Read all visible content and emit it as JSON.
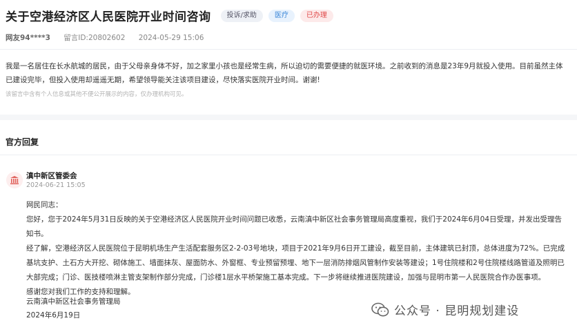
{
  "page": {
    "title": "关于空港经济区人民医院开业时间咨询",
    "tags": [
      "投诉/求助",
      "医疗",
      "已办理"
    ]
  },
  "meta": {
    "user": "网友94****3",
    "message_id": "留言ID:20802602",
    "datetime": "2024-05-29 15:06"
  },
  "message": {
    "body": "我是一名居住在长水航城的居民，由于父母亲身体不好，加之家里小孩也是经常生病，所以迫切的需要便捷的就医环境。之前收到的消息是23年9月就投入使用。目前虽然主体已建设完毕，但投入使用却遥遥无期，希望领导能关注该项目建设，尽快落实医院开业时间。谢谢!",
    "note": "该留言中含有个人信息或其他不便公开展示的内容，仅办理机构可见。"
  },
  "official_reply": {
    "section_title": "官方回复",
    "org_name": "滇中新区管委会",
    "date": "2024-06-21 15:05",
    "greeting": "网民同志：",
    "paragraph1": "您好，您于2024年5月31日反映的关于空港经济区人民医院开业时间问题已收悉，云南滇中新区社会事务管理局高度重视，我们于2024年6月04日受理，并发出受理告知书。",
    "paragraph2": "经了解，空港经济区人民医院位于昆明机场生产生活配套服务区2-2-03号地块，项目于2021年9月6日开工建设，截至目前，主体建筑已封顶，总体进度为72%。已完成基坑支护、土石方大开挖、砌体施工、墙面抹灰、屋面防水、外窗框、专业预留预埋、地下一层消防排烟风管制作安装等建设；1号住院楼和2号住院楼线路管道及照明已大部完成；门诊、医技楼喷淋主管支架制作部分完成，门诊楼1层水平桥架施工基本完成。下一步将继续推进医院建设，加强与昆明市第一人民医院合作办医事项。",
    "thanks": "感谢您对我们工作的支持和理解。",
    "signature": "云南滇中新区社会事务管理局",
    "signature_date": "2024年6月19日"
  },
  "watermark": {
    "text": "公众号 · 昆明规划建设"
  },
  "colors": {
    "tag_gray_bg": "#eef1f6",
    "tag_blue": "#3a86d8",
    "tag_red": "#e04848",
    "divider": "#eceef2"
  },
  "icons": {
    "org": "government-building-icon",
    "watermark": "wechat-icon"
  }
}
